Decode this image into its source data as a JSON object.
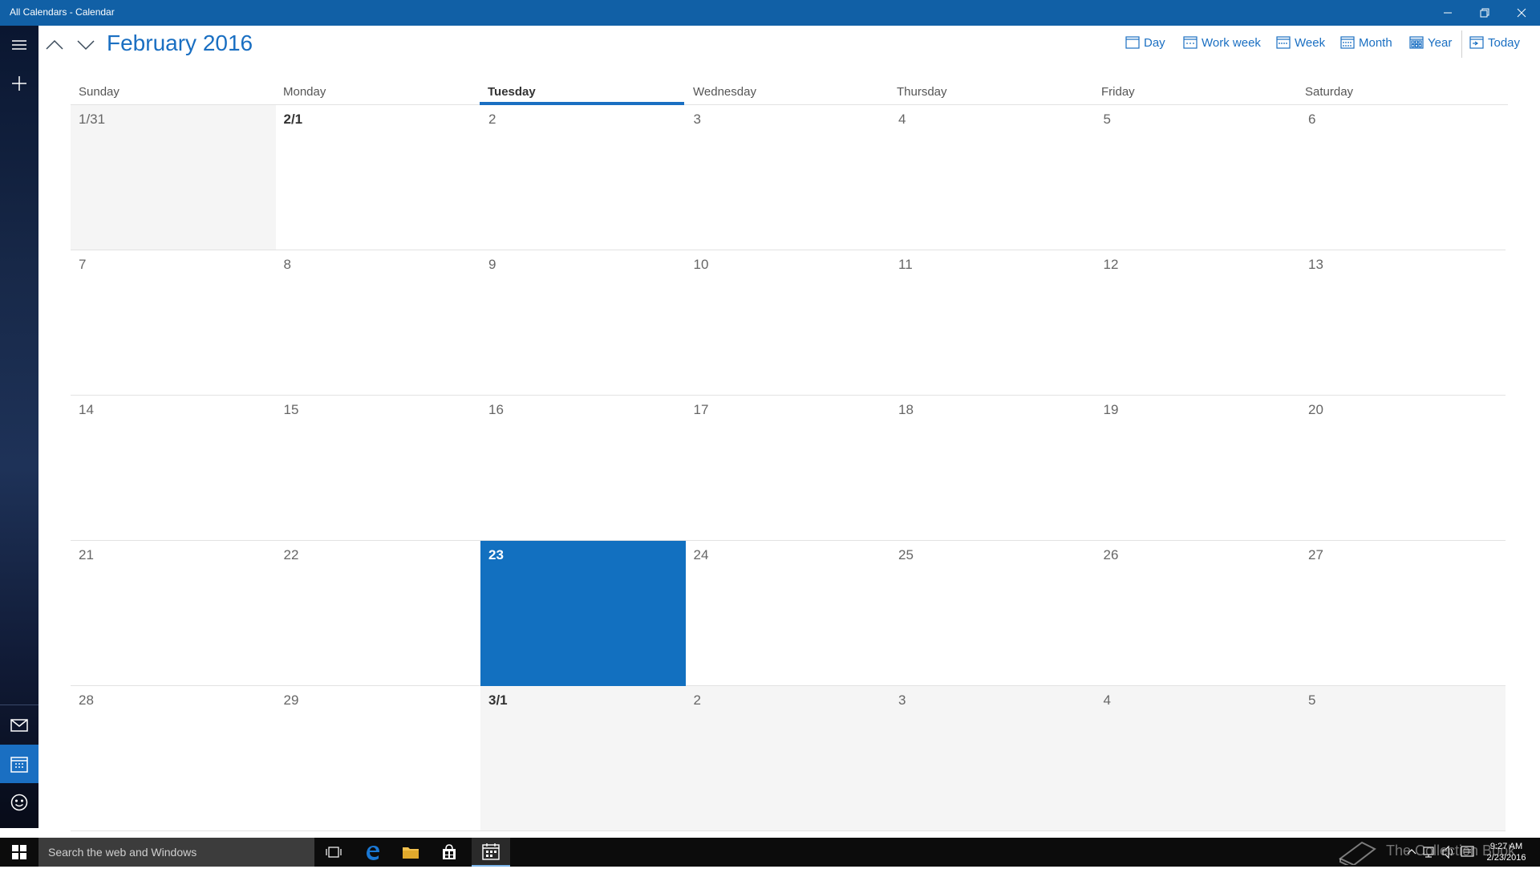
{
  "window": {
    "title": "All Calendars - Calendar",
    "controls": [
      "minimize-icon",
      "restore-icon",
      "close-icon"
    ]
  },
  "header": {
    "month_title": "February 2016",
    "views": [
      {
        "label": "Day",
        "icon": "day-view-icon"
      },
      {
        "label": "Work week",
        "icon": "work-week-icon"
      },
      {
        "label": "Week",
        "icon": "week-view-icon"
      },
      {
        "label": "Month",
        "icon": "month-view-icon"
      },
      {
        "label": "Year",
        "icon": "year-view-icon"
      },
      {
        "label": "Today",
        "icon": "today-icon"
      }
    ]
  },
  "weekdays": [
    "Sunday",
    "Monday",
    "Tuesday",
    "Wednesday",
    "Thursday",
    "Friday",
    "Saturday"
  ],
  "today_weekday_index": 2,
  "weeks": [
    [
      {
        "label": "1/31",
        "other": true,
        "bold": false
      },
      {
        "label": "2/1",
        "other": false,
        "bold": true
      },
      {
        "label": "2",
        "other": false,
        "bold": false
      },
      {
        "label": "3",
        "other": false,
        "bold": false
      },
      {
        "label": "4",
        "other": false,
        "bold": false
      },
      {
        "label": "5",
        "other": false,
        "bold": false
      },
      {
        "label": "6",
        "other": false,
        "bold": false
      }
    ],
    [
      {
        "label": "7"
      },
      {
        "label": "8"
      },
      {
        "label": "9"
      },
      {
        "label": "10"
      },
      {
        "label": "11"
      },
      {
        "label": "12"
      },
      {
        "label": "13"
      }
    ],
    [
      {
        "label": "14"
      },
      {
        "label": "15"
      },
      {
        "label": "16"
      },
      {
        "label": "17"
      },
      {
        "label": "18"
      },
      {
        "label": "19"
      },
      {
        "label": "20"
      }
    ],
    [
      {
        "label": "21"
      },
      {
        "label": "22"
      },
      {
        "label": "23",
        "today": true
      },
      {
        "label": "24"
      },
      {
        "label": "25"
      },
      {
        "label": "26"
      },
      {
        "label": "27"
      }
    ],
    [
      {
        "label": "28"
      },
      {
        "label": "29"
      },
      {
        "label": "3/1",
        "other": true,
        "bold": true
      },
      {
        "label": "2",
        "other": true
      },
      {
        "label": "3",
        "other": true
      },
      {
        "label": "4",
        "other": true
      },
      {
        "label": "5",
        "other": true
      }
    ]
  ],
  "rail": {
    "items": [
      "hamburger-menu-icon",
      "new-event-icon",
      "mail-icon",
      "calendar-icon",
      "people-icon",
      "settings-icon"
    ],
    "active": "calendar-icon"
  },
  "taskbar": {
    "search_placeholder": "Search the web and Windows",
    "time": "9:27 AM",
    "date": "2/23/2016",
    "watermark": "The Collection Book"
  },
  "colors": {
    "accent": "#1a6fc2",
    "titlebar": "#1160a6",
    "today_cell": "#1270c0",
    "other_month_bg": "#f5f5f5"
  }
}
